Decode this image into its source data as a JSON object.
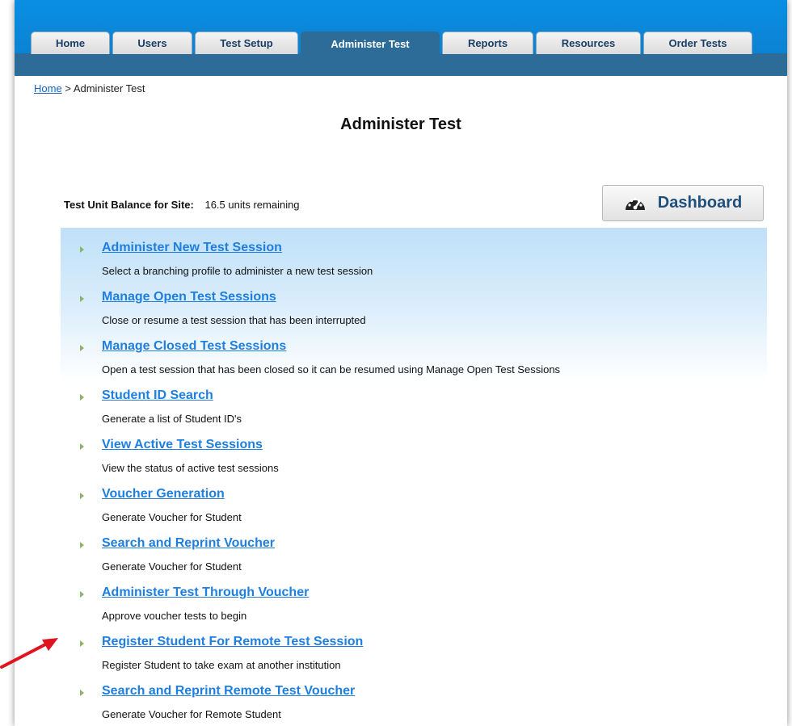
{
  "nav": {
    "tabs": [
      {
        "label": "Home"
      },
      {
        "label": "Users"
      },
      {
        "label": "Test Setup"
      },
      {
        "label": "Administer Test",
        "active": true
      },
      {
        "label": "Reports"
      },
      {
        "label": "Resources"
      },
      {
        "label": "Order Tests"
      }
    ]
  },
  "breadcrumb": {
    "home_link": "Home",
    "separator": ">",
    "current": "Administer Test"
  },
  "page": {
    "title": "Administer Test"
  },
  "balance": {
    "label": "Test Unit Balance for Site:",
    "value": "16.5 units remaining"
  },
  "dashboard": {
    "label": "Dashboard",
    "icon": "speedometer-icon"
  },
  "menu": {
    "items": [
      {
        "title": "Administer New Test Session",
        "description": "Select a branching profile to administer a new test session"
      },
      {
        "title": "Manage Open Test Sessions",
        "description": "Close or resume a test session that has been interrupted"
      },
      {
        "title": "Manage Closed Test Sessions",
        "description": "Open a test session that has been closed so it can be resumed using Manage Open Test Sessions"
      },
      {
        "title": "Student ID Search",
        "description": "Generate a list of Student ID's"
      },
      {
        "title": "View Active Test Sessions",
        "description": "View the status of active test sessions"
      },
      {
        "title": "Voucher Generation",
        "description": "Generate Voucher for Student"
      },
      {
        "title": "Search and Reprint Voucher",
        "description": "Generate Voucher for Student"
      },
      {
        "title": "Administer Test Through Voucher",
        "description": "Approve voucher tests to begin"
      },
      {
        "title": "Register Student For Remote Test Session",
        "description": "Register Student to take exam at another institution"
      },
      {
        "title": "Search and Reprint Remote Test Voucher",
        "description": "Generate Voucher for Remote Student"
      }
    ]
  },
  "colors": {
    "header_blue": "#0a8fe4",
    "nav_band": "#2d6c98",
    "link_blue": "#1e7fe0",
    "bullet_green": "#8bb36a",
    "annotation_red": "#e0141e"
  }
}
